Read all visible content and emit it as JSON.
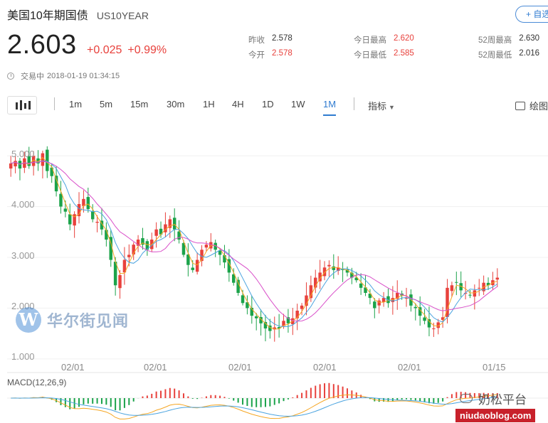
{
  "header": {
    "name": "美国10年期国债",
    "code": "US10YEAR",
    "add_label": "+ 自选",
    "price": "2.603",
    "change": "+0.025",
    "change_pct": "+0.99%",
    "status": "交易中",
    "timestamp": "2018-01-19 01:34:15"
  },
  "stats": {
    "prev_close_label": "昨收",
    "prev_close": "2.578",
    "open_label": "今开",
    "open": "2.578",
    "day_high_label": "今日最高",
    "day_high": "2.620",
    "day_low_label": "今日最低",
    "day_low": "2.585",
    "wk52_high_label": "52周最高",
    "wk52_high": "2.630",
    "wk52_low_label": "52周最低",
    "wk52_low": "2.016"
  },
  "toolbar": {
    "timeframes": [
      "1m",
      "5m",
      "15m",
      "30m",
      "1H",
      "4H",
      "1D",
      "1W",
      "1M"
    ],
    "active": "1M",
    "indicators_label": "指标",
    "draw_label": "绘图"
  },
  "colors": {
    "up": "#e8413c",
    "down": "#1ba34a",
    "accent": "#2f7bd0"
  },
  "chart_data": {
    "type": "candlestick",
    "ylim": [
      0.9,
      5.45
    ],
    "yticks": [
      "5.000",
      "4.000",
      "3.000",
      "2.000",
      "1.000"
    ],
    "ytick_values": [
      5,
      4,
      3,
      2,
      1
    ],
    "xticks": [
      "02/01",
      "02/01",
      "02/01",
      "02/01",
      "02/01",
      "01/15"
    ],
    "close_series": [
      4.85,
      4.9,
      4.75,
      4.95,
      4.8,
      5.0,
      4.85,
      5.05,
      4.7,
      4.6,
      4.3,
      4.0,
      3.9,
      3.65,
      3.85,
      4.05,
      4.15,
      3.95,
      3.75,
      3.7,
      3.55,
      3.35,
      2.95,
      2.45,
      2.65,
      2.95,
      3.05,
      3.25,
      3.35,
      3.25,
      3.15,
      3.35,
      3.55,
      3.45,
      3.65,
      3.75,
      3.55,
      3.35,
      3.05,
      2.85,
      2.75,
      2.95,
      3.15,
      3.25,
      3.3,
      3.15,
      3.05,
      2.9,
      2.7,
      2.5,
      2.3,
      2.1,
      2.0,
      1.85,
      1.8,
      1.7,
      1.6,
      1.55,
      1.62,
      1.6,
      1.75,
      1.7,
      1.8,
      1.95,
      2.05,
      2.25,
      2.45,
      2.6,
      2.7,
      2.8,
      2.85,
      2.75,
      2.8,
      2.75,
      2.7,
      2.6,
      2.55,
      2.4,
      2.3,
      2.2,
      2.0,
      2.15,
      2.2,
      2.1,
      2.2,
      2.3,
      2.25,
      2.2,
      2.05,
      2.0,
      1.85,
      1.75,
      1.62,
      1.6,
      1.72,
      1.82,
      2.4,
      2.45,
      2.5,
      2.35,
      2.3,
      2.25,
      2.35,
      2.4,
      2.5,
      2.45,
      2.55,
      2.6
    ],
    "macd_label": "MACD(12,26,9)"
  },
  "watermarks": {
    "logo_letter": "W",
    "logo_text": "华尔街见闻",
    "site_title": "奶松平台",
    "site_url": "niudaoblog.com"
  }
}
